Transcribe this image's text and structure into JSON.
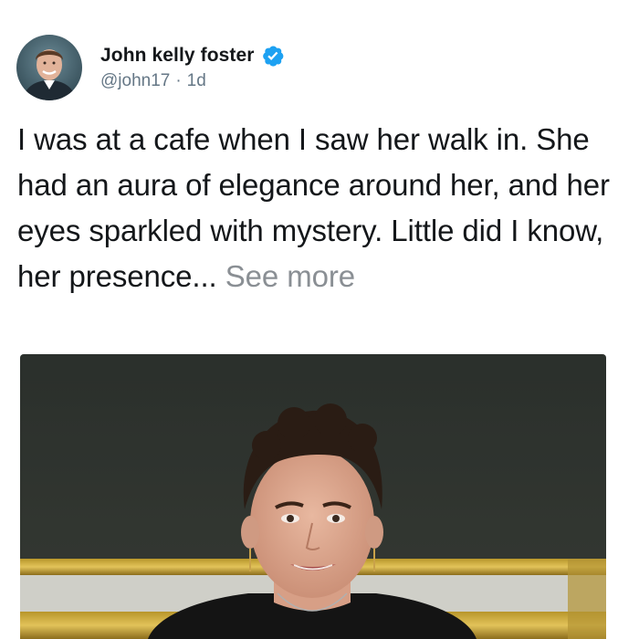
{
  "author": {
    "display_name": "John kelly foster",
    "handle": "@john17",
    "timestamp": "1d",
    "separator": "·",
    "verified": true,
    "avatar_icon": "profile-photo"
  },
  "post": {
    "text": "I was at a cafe when I saw her walk in. She had an aura of elegance around her, and her eyes sparkled with mystery. Little did I know, her presence...",
    "see_more_label": "See more"
  },
  "media": {
    "type": "photo",
    "description_icon": "woman-portrait-photo"
  },
  "colors": {
    "text": "#14171a",
    "secondary": "#657786",
    "see_more": "#8a8f94",
    "verified_badge": "#1da1f2"
  }
}
